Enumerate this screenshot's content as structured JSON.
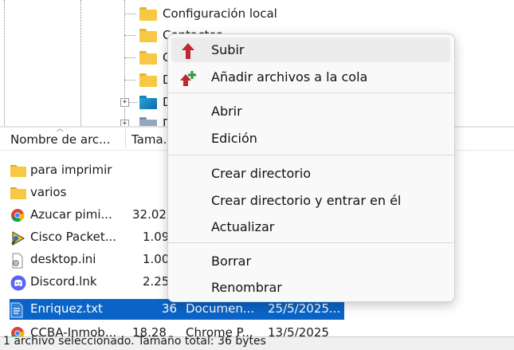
{
  "tree": {
    "items": [
      {
        "label": "Configuración local"
      },
      {
        "label": "Contactos"
      },
      {
        "label": "C"
      },
      {
        "label": "D"
      },
      {
        "label": "D"
      },
      {
        "label": "D"
      }
    ]
  },
  "list": {
    "columns": [
      "Nombre de arc...",
      "Tama...",
      "",
      ""
    ],
    "rows": [
      {
        "name": "para imprimir",
        "size": "",
        "type": "",
        "date": "",
        "icon": "folder-icon"
      },
      {
        "name": "varios",
        "size": "",
        "type": "",
        "date": "",
        "icon": "folder-icon"
      },
      {
        "name": "Azucar pimi...",
        "size": "32.02",
        "type": "",
        "date": "",
        "icon": "chrome-icon"
      },
      {
        "name": "Cisco Packet...",
        "size": "1.09",
        "type": "",
        "date": "",
        "icon": "cisco-packet-tracer-icon"
      },
      {
        "name": "desktop.ini",
        "size": "1.00",
        "type": "",
        "date": "",
        "icon": "settings-file-icon"
      },
      {
        "name": "Discord.lnk",
        "size": "2.25",
        "type": "",
        "date": "",
        "icon": "discord-icon"
      },
      {
        "name": "Enriquez.txt",
        "size": "36",
        "type": "Documen...",
        "date": "25/5/2025...",
        "icon": "text-file-icon",
        "selected": true
      },
      {
        "name": "CCBA-Inmob...",
        "size": "18.28",
        "type": "Chrome P...",
        "date": "13/5/2025",
        "icon": "chrome-icon"
      }
    ]
  },
  "status_bar": {
    "text": "1 archivo seleccionado. Tamaño total: 36 bytes"
  },
  "context_menu": {
    "items": [
      {
        "label": "Subir",
        "icon": "upload-arrow-icon"
      },
      {
        "label": "Añadir archivos a la cola",
        "icon": "add-to-queue-icon"
      },
      {
        "label": "Abrir"
      },
      {
        "label": "Edición"
      },
      {
        "label": "Crear directorio"
      },
      {
        "label": "Crear directorio y entrar en él"
      },
      {
        "label": "Actualizar"
      },
      {
        "label": "Borrar"
      },
      {
        "label": "Renombrar"
      }
    ]
  },
  "colors": {
    "selection": "#0a64c8",
    "upload_arrow": "#c0282d",
    "queue_plus": "#2ea043",
    "folder": "#f7c843"
  }
}
